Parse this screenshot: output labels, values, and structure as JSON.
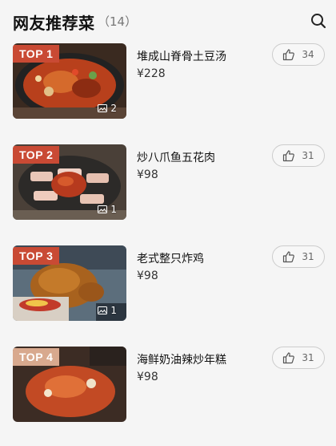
{
  "header": {
    "title": "网友推荐菜",
    "count": "（14）"
  },
  "dishes": [
    {
      "rank": "TOP 1",
      "name": "堆成山脊骨土豆汤",
      "price": "¥228",
      "photos": "2",
      "likes": "34",
      "rank_color": "#c94a34"
    },
    {
      "rank": "TOP 2",
      "name": "炒八爪鱼五花肉",
      "price": "¥98",
      "photos": "1",
      "likes": "31",
      "rank_color": "#c94a34"
    },
    {
      "rank": "TOP 3",
      "name": "老式整只炸鸡",
      "price": "¥98",
      "photos": "1",
      "likes": "31",
      "rank_color": "#c94a34"
    },
    {
      "rank": "TOP 4",
      "name": "海鲜奶油辣炒年糕",
      "price": "¥98",
      "photos": "",
      "likes": "31",
      "rank_color": "#d8a98e"
    }
  ]
}
